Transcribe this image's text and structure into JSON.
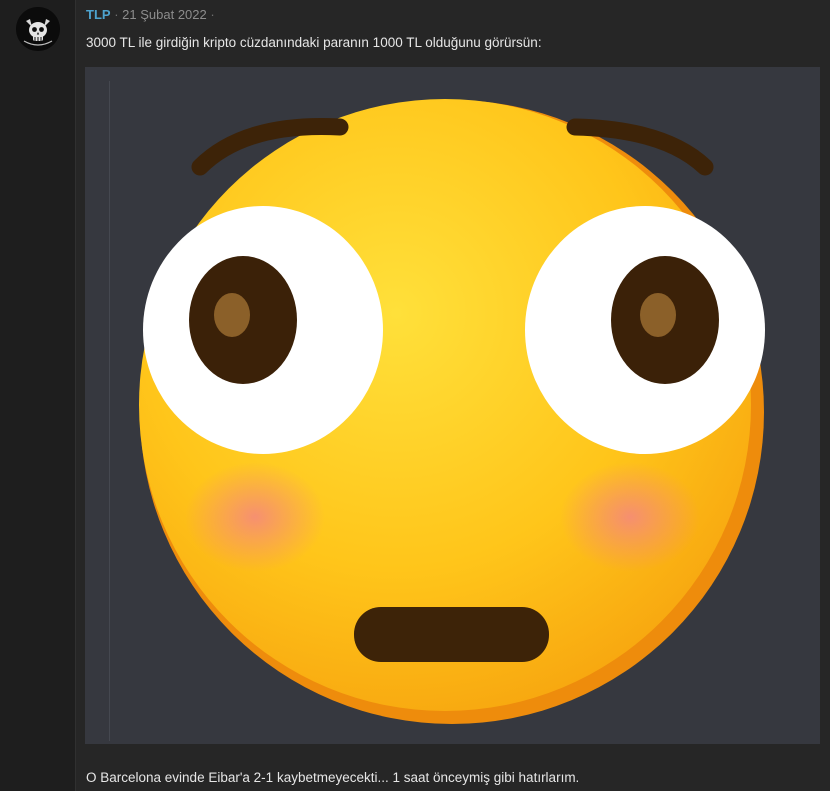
{
  "post": {
    "username": "TLP",
    "separator_1": "·",
    "date": "21 Şubat 2022",
    "separator_2": "·",
    "message": "3000 TL ile girdiğin kripto cüzdanındaki paranın 1000 TL olduğunu görürsün:",
    "message_2": "O Barcelona evinde Eibar'a 2-1 kaybetmeyecekti... 1 saat önceymiş gibi hatırlarım."
  },
  "avatar": {
    "icon": "skull-icon"
  },
  "image": {
    "icon": "flushed-face-emoji"
  },
  "colors": {
    "background": "#232323",
    "post_background": "#262626",
    "username": "#4da3cf",
    "image_background": "#36383f",
    "emoji_yellow": "#ffc51a",
    "emoji_orange": "#f39c12"
  }
}
